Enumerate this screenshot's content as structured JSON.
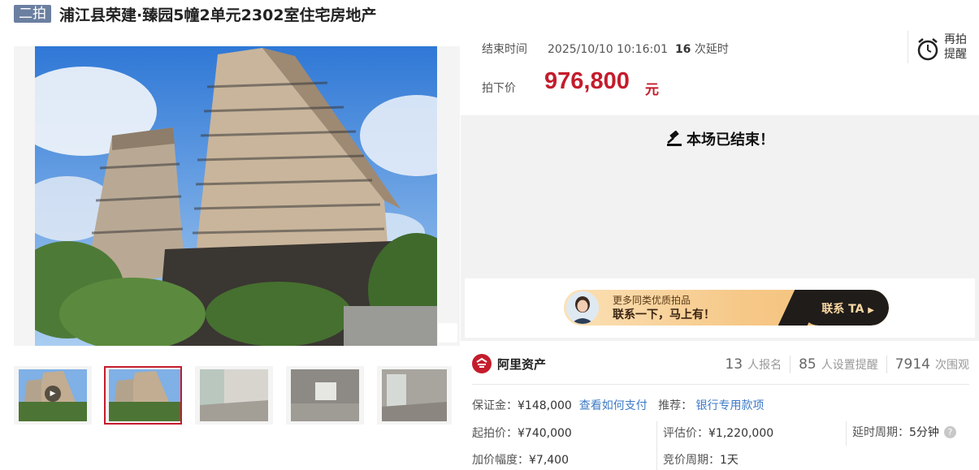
{
  "header": {
    "badge": "二拍",
    "title": "浦江县荣建·臻园5幢2单元2302室住宅房地产"
  },
  "auction": {
    "end_label": "结束时间",
    "end_time": "2025/10/10 10:16:01",
    "delay_count": "16",
    "delay_suffix": " 次延时",
    "price_label": "拍下价",
    "price": "976,800",
    "currency": "元",
    "remind_label": "再拍提醒",
    "ended_text": "本场已结束！"
  },
  "promo": {
    "line1": "更多同类优质拍品",
    "line2": "联系一下，马上有！",
    "button": "联系 TA"
  },
  "brand": {
    "name": "阿里资产"
  },
  "stats": [
    {
      "num": "13",
      "label": "人报名"
    },
    {
      "num": "85",
      "label": "人设置提醒"
    },
    {
      "num": "7914",
      "label": "次围观"
    }
  ],
  "details": {
    "deposit_label": "保证金：",
    "deposit_value": "¥148,000",
    "pay_link": "查看如何支付",
    "recommend_label": "推荐：",
    "recommend_link": "银行专用款项",
    "start_label": "起拍价：",
    "start_value": "¥740,000",
    "appraisal_label": "评估价：",
    "appraisal_value": "¥1,220,000",
    "delay_period_label": "延时周期：",
    "delay_period_value": "5分钟",
    "increment_label": "加价幅度：",
    "increment_value": "¥7,400",
    "bid_period_label": "竞价周期：",
    "bid_period_value": "1天"
  },
  "colors": {
    "accent_red": "#c41c2c",
    "link_blue": "#3e7bc6",
    "badge_bg": "#6b7fa0"
  },
  "icons": [
    "alarm-clock-icon",
    "gavel-icon",
    "zoom-icon",
    "play-icon",
    "brand-logo-icon",
    "help-icon"
  ]
}
